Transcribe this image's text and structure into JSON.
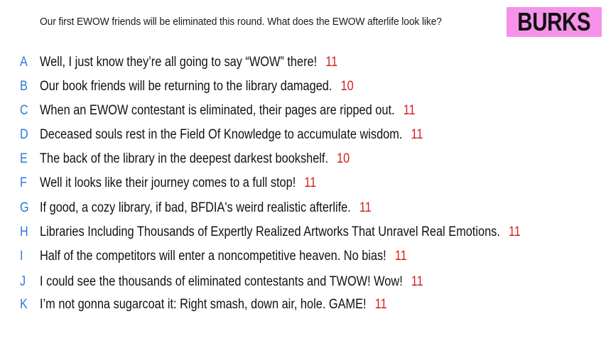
{
  "prompt": "Our first EWOW friends will be eliminated this round. What does the EWOW afterlife look like?",
  "contestant_name": "BURKS",
  "colors": {
    "letter": "#2d7ad6",
    "score": "#d81f1f",
    "badge": "#f692e9"
  },
  "responses": [
    {
      "letter": "A",
      "text": "Well, I just know they’re all going to say “WOW” there!",
      "score": "11"
    },
    {
      "letter": "B",
      "text": "Our book friends will be returning to the library damaged.",
      "score": "10"
    },
    {
      "letter": "C",
      "text": "When an EWOW contestant is eliminated, their pages are ripped out.",
      "score": "11"
    },
    {
      "letter": "D",
      "text": "Deceased souls rest in the Field Of Knowledge to accumulate wisdom.",
      "score": "11"
    },
    {
      "letter": "E",
      "text": "The back of the library in the deepest darkest bookshelf.",
      "score": "10"
    },
    {
      "letter": "F",
      "text": "Well it looks like their journey comes to a full stop!",
      "score": "11"
    },
    {
      "letter": "G",
      "text": "If good, a cozy library, if bad, BFDIA's weird realistic afterlife.",
      "score": "11"
    },
    {
      "letter": "H",
      "text": "Libraries Including Thousands of Expertly Realized Artworks That Unravel Real Emotions.",
      "score": "11"
    },
    {
      "letter": "I",
      "text": "Half of the competitors will enter a noncompetitive heaven. No bias!",
      "score": "11"
    },
    {
      "letter": "J",
      "text": "I could see the thousands of eliminated contestants and TWOW! Wow!",
      "score": "11"
    },
    {
      "letter": "K",
      "text": "I’m not gonna sugarcoat it: Right smash, down air, hole. GAME!",
      "score": "11"
    }
  ]
}
